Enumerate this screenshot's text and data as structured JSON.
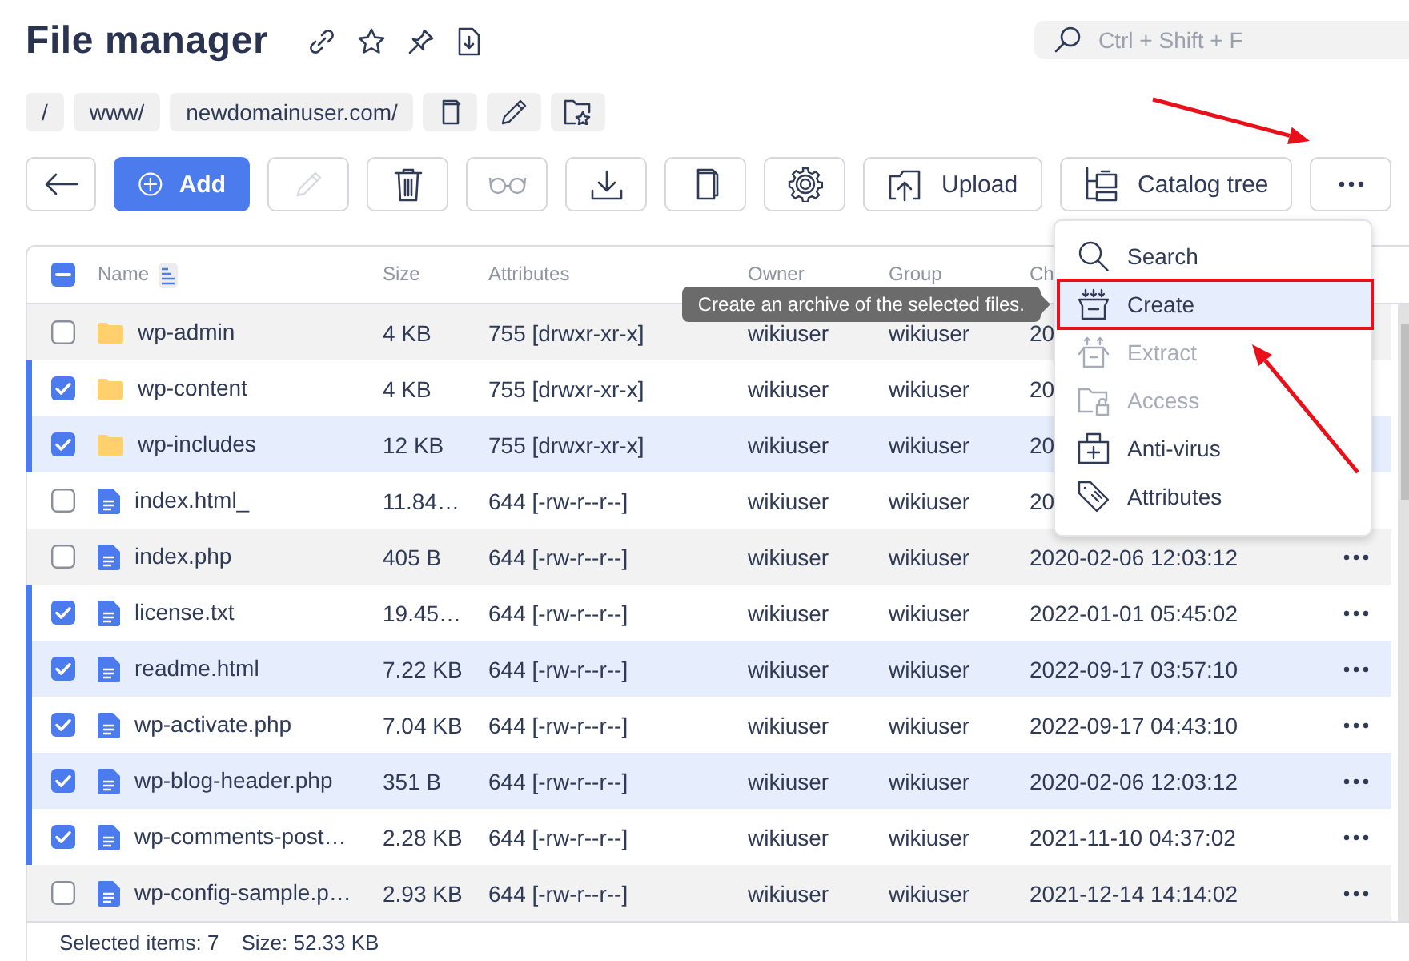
{
  "page": {
    "title": "File manager"
  },
  "search": {
    "placeholder": "Ctrl + Shift + F"
  },
  "breadcrumbs": [
    "/",
    "www/",
    "newdomainuser.com/"
  ],
  "toolbar": [
    {
      "kind": "back",
      "disabled": false
    },
    {
      "kind": "add",
      "label": "Add",
      "disabled": false
    },
    {
      "kind": "edit",
      "disabled": true
    },
    {
      "kind": "delete",
      "disabled": false
    },
    {
      "kind": "view",
      "disabled": true
    },
    {
      "kind": "download",
      "disabled": false
    },
    {
      "kind": "copy",
      "disabled": false
    },
    {
      "kind": "settings",
      "disabled": false
    },
    {
      "kind": "upload",
      "label": "Upload",
      "disabled": false
    },
    {
      "kind": "tree",
      "label": "Catalog tree",
      "disabled": false
    },
    {
      "kind": "more",
      "disabled": false
    }
  ],
  "table": {
    "select_all": {
      "indeterminate": true
    },
    "columns": [
      "Name",
      "Size",
      "Attributes",
      "Owner",
      "Group",
      "Ch"
    ],
    "rows": [
      {
        "kind": "folder",
        "name": "wp-admin",
        "size": "4 KB",
        "attributes": "755 [drwxr-xr-x]",
        "owner": "wikiuser",
        "group": "wikiuser",
        "changed": "20",
        "selected": false
      },
      {
        "kind": "folder",
        "name": "wp-content",
        "size": "4 KB",
        "attributes": "755 [drwxr-xr-x]",
        "owner": "wikiuser",
        "group": "wikiuser",
        "changed": "20",
        "selected": true
      },
      {
        "kind": "folder",
        "name": "wp-includes",
        "size": "12 KB",
        "attributes": "755 [drwxr-xr-x]",
        "owner": "wikiuser",
        "group": "wikiuser",
        "changed": "20",
        "selected": true
      },
      {
        "kind": "file",
        "name": "index.html_",
        "size": "11.84…",
        "attributes": "644 [-rw-r--r--]",
        "owner": "wikiuser",
        "group": "wikiuser",
        "changed": "20",
        "selected": false
      },
      {
        "kind": "file",
        "name": "index.php",
        "size": "405 B",
        "attributes": "644 [-rw-r--r--]",
        "owner": "wikiuser",
        "group": "wikiuser",
        "changed": "2020-02-06 12:03:12",
        "selected": false
      },
      {
        "kind": "file",
        "name": "license.txt",
        "size": "19.45…",
        "attributes": "644 [-rw-r--r--]",
        "owner": "wikiuser",
        "group": "wikiuser",
        "changed": "2022-01-01 05:45:02",
        "selected": true
      },
      {
        "kind": "file",
        "name": "readme.html",
        "size": "7.22 KB",
        "attributes": "644 [-rw-r--r--]",
        "owner": "wikiuser",
        "group": "wikiuser",
        "changed": "2022-09-17 03:57:10",
        "selected": true
      },
      {
        "kind": "file",
        "name": "wp-activate.php",
        "size": "7.04 KB",
        "attributes": "644 [-rw-r--r--]",
        "owner": "wikiuser",
        "group": "wikiuser",
        "changed": "2022-09-17 04:43:10",
        "selected": true
      },
      {
        "kind": "file",
        "name": "wp-blog-header.php",
        "size": "351 B",
        "attributes": "644 [-rw-r--r--]",
        "owner": "wikiuser",
        "group": "wikiuser",
        "changed": "2020-02-06 12:03:12",
        "selected": true
      },
      {
        "kind": "file",
        "name": "wp-comments-post…",
        "size": "2.28 KB",
        "attributes": "644 [-rw-r--r--]",
        "owner": "wikiuser",
        "group": "wikiuser",
        "changed": "2021-11-10 04:37:02",
        "selected": true
      },
      {
        "kind": "file",
        "name": "wp-config-sample.p…",
        "size": "2.93 KB",
        "attributes": "644 [-rw-r--r--]",
        "owner": "wikiuser",
        "group": "wikiuser",
        "changed": "2021-12-14 14:14:02",
        "selected": false
      }
    ],
    "footer": {
      "selected": "Selected items: 7",
      "size": "Size: 52.33 KB"
    }
  },
  "tooltip": {
    "text": "Create an archive of the selected files."
  },
  "menu": {
    "items": [
      {
        "kind": "search",
        "label": "Search",
        "disabled": false,
        "selected": false,
        "highlighted": false
      },
      {
        "kind": "create",
        "label": "Create",
        "disabled": false,
        "selected": true,
        "highlighted": true
      },
      {
        "kind": "extract",
        "label": "Extract",
        "disabled": true,
        "selected": false,
        "highlighted": false
      },
      {
        "kind": "access",
        "label": "Access",
        "disabled": true,
        "selected": false,
        "highlighted": false
      },
      {
        "kind": "antivirus",
        "label": "Anti-virus",
        "disabled": false,
        "selected": false,
        "highlighted": false
      },
      {
        "kind": "attributes",
        "label": "Attributes",
        "disabled": false,
        "selected": false,
        "highlighted": false
      }
    ]
  },
  "annotations": [
    {
      "kind": "arrow"
    },
    {
      "kind": "arrow"
    }
  ]
}
